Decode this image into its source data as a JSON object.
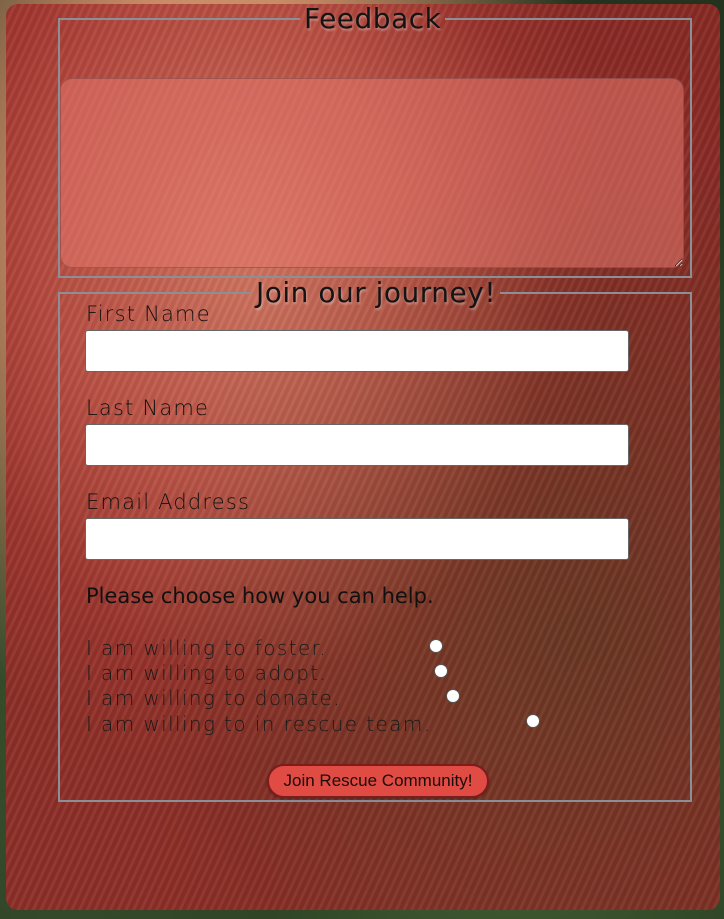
{
  "feedback": {
    "legend": "Feedback",
    "textarea_value": ""
  },
  "join": {
    "legend": "Join our journey!",
    "first_name_label": "First Name",
    "first_name_value": "",
    "last_name_label": "Last Name",
    "last_name_value": "",
    "email_label": "Email Address",
    "email_value": "",
    "help_heading": "Please choose how you can help.",
    "options": [
      "I am willing to foster.",
      "I am willing to adopt.",
      "I am willing to donate.",
      "I am willing to in rescue team."
    ],
    "submit_label": "Join Rescue Community!"
  },
  "colors": {
    "panel_overlay": "#a42626",
    "button_bg": "#e04b43",
    "fieldset_border": "#8b8f98"
  }
}
